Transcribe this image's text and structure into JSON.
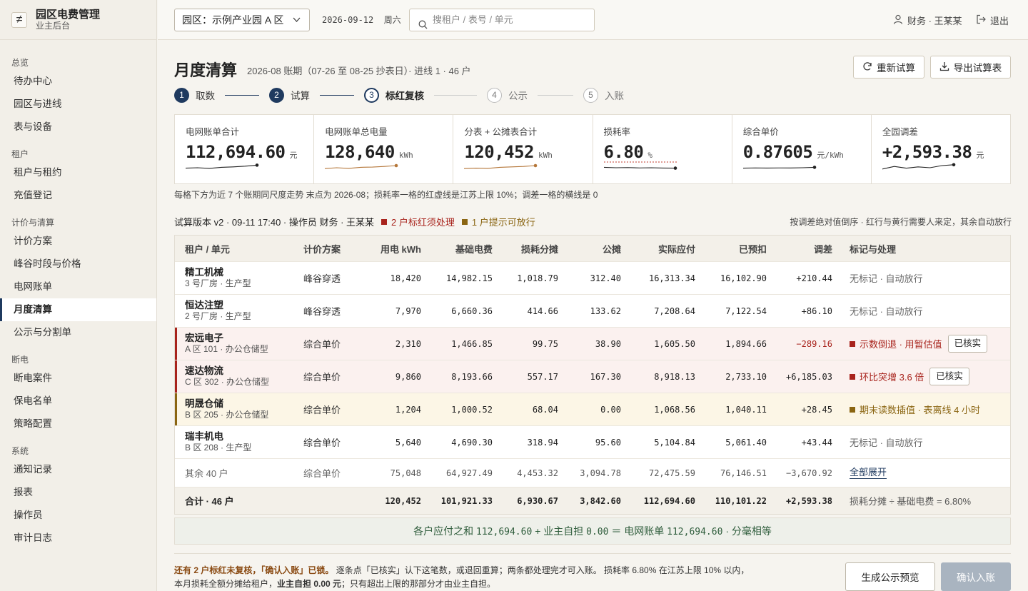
{
  "brand": {
    "title": "园区电费管理",
    "subtitle": "业主后台",
    "logo_glyph": "≠"
  },
  "sidebar": {
    "groups": [
      {
        "label": "总览",
        "items": [
          "待办中心",
          "园区与进线",
          "表与设备"
        ]
      },
      {
        "label": "租户",
        "items": [
          "租户与租约",
          "充值登记"
        ]
      },
      {
        "label": "计价与清算",
        "items": [
          "计价方案",
          "峰谷时段与价格",
          "电网账单",
          "月度清算",
          "公示与分割单"
        ]
      },
      {
        "label": "断电",
        "items": [
          "断电案件",
          "保电名单",
          "策略配置"
        ]
      },
      {
        "label": "系统",
        "items": [
          "通知记录",
          "报表",
          "操作员",
          "审计日志"
        ]
      }
    ],
    "active": "月度清算"
  },
  "topbar": {
    "park": "园区：示例产业园 A 区",
    "date": "2026-09-12  周六",
    "search_placeholder": "搜租户 / 表号 / 单元",
    "user": "财务 · 王某某",
    "logout": "退出"
  },
  "header": {
    "title": "月度清算",
    "subtitle": "2026-08 账期（07-26 至 08-25 抄表日）· 进线 1 · 46 户",
    "recompute": "重新试算",
    "export": "导出试算表"
  },
  "steps": [
    {
      "n": "1",
      "label": "取数",
      "state": "done"
    },
    {
      "n": "2",
      "label": "试算",
      "state": "done"
    },
    {
      "n": "3",
      "label": "标红复核",
      "state": "current"
    },
    {
      "n": "4",
      "label": "公示",
      "state": "todo"
    },
    {
      "n": "5",
      "label": "入账",
      "state": "todo"
    }
  ],
  "kpis": [
    {
      "label": "电网账单合计",
      "value": "112,694.60",
      "unit": "元",
      "color": "#222222",
      "trend": [
        0.45,
        0.5,
        0.42,
        0.55,
        0.6,
        0.68,
        0.8
      ]
    },
    {
      "label": "电网账单总电量",
      "value": "128,640",
      "unit": "kWh",
      "color": "#b5773a",
      "trend": [
        0.4,
        0.5,
        0.42,
        0.55,
        0.58,
        0.65,
        0.75
      ]
    },
    {
      "label": "分表 + 公摊表合计",
      "value": "120,452",
      "unit": "kWh",
      "color": "#b5773a",
      "trend": [
        0.4,
        0.45,
        0.42,
        0.55,
        0.6,
        0.65,
        0.75
      ]
    },
    {
      "label": "损耗率",
      "value": "6.80",
      "unit": "%",
      "color": "#222222",
      "trend": [
        0.55,
        0.5,
        0.52,
        0.48,
        0.5,
        0.46,
        0.45
      ],
      "limit": true
    },
    {
      "label": "综合单价",
      "value": "0.87605",
      "unit": "元/kWh",
      "color": "#222222",
      "trend": [
        0.45,
        0.48,
        0.46,
        0.48,
        0.47,
        0.5,
        0.55
      ]
    },
    {
      "label": "全园调差",
      "value": "+2,593.38",
      "unit": "元",
      "color": "#222222",
      "trend": [
        0.35,
        0.65,
        0.45,
        0.6,
        0.5,
        0.75,
        0.85
      ]
    }
  ],
  "kpi_note": "每格下方为近 7 个账期同尺度走势  末点为 2026-08；损耗率一格的红虚线是江苏上限 10%；调差一格的横线是 0",
  "version": {
    "text": "试算版本 v2 · 09-11 17:40 · 操作员 财务 · 王某某",
    "red_text": "2 户标红须处理",
    "yellow_text": "1 户提示可放行",
    "right_text": "按调差绝对值倒序 · 红行与黄行需要人来定，其余自动放行",
    "red_color": "#a8231c",
    "yellow_color": "#8a6512"
  },
  "table": {
    "headers": [
      "租户 / 单元",
      "计价方案",
      "用电 kWh",
      "基础电费",
      "损耗分摊",
      "公摊",
      "实际应付",
      "已预扣",
      "调差",
      "标记与处理"
    ],
    "rows": [
      {
        "name": "精工机械",
        "unit": "3 号厂房 · 生产型",
        "plan": "峰谷穿透",
        "kwh": "18,420",
        "base": "14,982.15",
        "loss": "1,018.79",
        "shared": "312.40",
        "due": "16,313.34",
        "prepaid": "16,102.90",
        "diff": "+210.44",
        "flag": "无标记 · 自动放行",
        "status": "none"
      },
      {
        "name": "恒达注塑",
        "unit": "2 号厂房 · 生产型",
        "plan": "峰谷穿透",
        "kwh": "7,970",
        "base": "6,660.36",
        "loss": "414.66",
        "shared": "133.62",
        "due": "7,208.64",
        "prepaid": "7,122.54",
        "diff": "+86.10",
        "flag": "无标记 · 自动放行",
        "status": "none"
      },
      {
        "name": "宏远电子",
        "unit": "A 区 101 · 办公仓储型",
        "plan": "综合单价",
        "kwh": "2,310",
        "base": "1,466.85",
        "loss": "99.75",
        "shared": "38.90",
        "due": "1,605.50",
        "prepaid": "1,894.66",
        "diff": "−289.16",
        "flag": "示数倒退 · 用暂估值",
        "status": "red",
        "action": "已核实"
      },
      {
        "name": "速达物流",
        "unit": "C 区 302 · 办公仓储型",
        "plan": "综合单价",
        "kwh": "9,860",
        "base": "8,193.66",
        "loss": "557.17",
        "shared": "167.30",
        "due": "8,918.13",
        "prepaid": "2,733.10",
        "diff": "+6,185.03",
        "flag": "环比突增 3.6 倍",
        "status": "red",
        "action": "已核实"
      },
      {
        "name": "明晟仓储",
        "unit": "B 区 205 · 办公仓储型",
        "plan": "综合单价",
        "kwh": "1,204",
        "base": "1,000.52",
        "loss": "68.04",
        "shared": "0.00",
        "due": "1,068.56",
        "prepaid": "1,040.11",
        "diff": "+28.45",
        "flag": "期末读数插值 · 表离线 4 小时",
        "status": "yellow"
      },
      {
        "name": "瑞丰机电",
        "unit": "B 区 208 · 生产型",
        "plan": "综合单价",
        "kwh": "5,640",
        "base": "4,690.30",
        "loss": "318.94",
        "shared": "95.60",
        "due": "5,104.84",
        "prepaid": "5,061.40",
        "diff": "+43.44",
        "flag": "无标记 · 自动放行",
        "status": "none"
      }
    ],
    "rest": {
      "label": "其余 40 户",
      "plan": "综合单价",
      "kwh": "75,048",
      "base": "64,927.49",
      "loss": "4,453.32",
      "shared": "3,094.78",
      "due": "72,475.59",
      "prepaid": "76,146.51",
      "diff": "−3,670.92",
      "flag": "全部展开"
    },
    "total": {
      "label": "合计 · 46 户",
      "kwh": "120,452",
      "base": "101,921.33",
      "loss": "6,930.67",
      "shared": "3,842.60",
      "due": "112,694.60",
      "prepaid": "110,101.22",
      "diff": "+2,593.38",
      "flag": "损耗分摊 ÷ 基础电费 = 6.80%"
    }
  },
  "balance": {
    "t1": "各户应付之和",
    "v1": "112,694.60",
    "t2": "+  业主自担",
    "v2": "0.00",
    "t3": "＝  电网账单",
    "v3": "112,694.60",
    "t4": "· 分毫相等"
  },
  "footer": {
    "warn": "还有 2 户标红未复核，「确认入账」已锁。",
    "text1": "逐条点「已核实」认下这笔数，或退回重算；两条都处理完才可入账。 损耗率 6.80% 在江苏上限 10% 以内，",
    "text2a": "本月损耗全额分摊给租户，",
    "text2b": "业主自担 0.00 元",
    "text2c": "；只有超出上限的那部分才由业主自担。",
    "preview": "生成公示预览",
    "confirm": "确认入账"
  }
}
